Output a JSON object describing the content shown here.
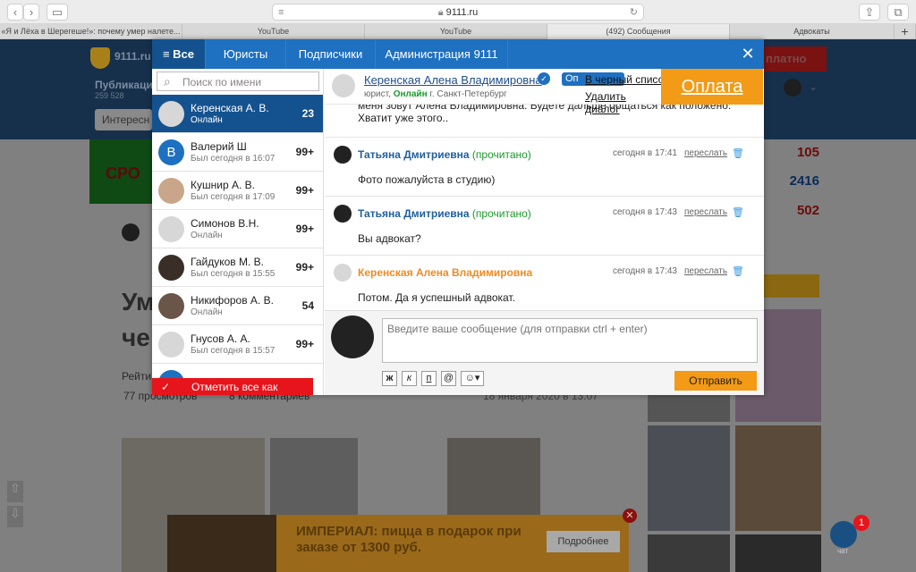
{
  "browser": {
    "url": "9111.ru",
    "tabs": [
      {
        "label": "«Я и Лёха в Шерегеше!»: почему умер налете...",
        "active": false
      },
      {
        "label": "YouTube",
        "active": false
      },
      {
        "label": "YouTube",
        "active": false
      },
      {
        "label": "(492) Сообщения",
        "active": true
      },
      {
        "label": "Адвокаты",
        "active": false
      }
    ]
  },
  "background": {
    "site_name": "9111.ru",
    "publications": "Публикаци",
    "pub_count": "259 528",
    "interesting": "Интересн",
    "headline_1": "Ум",
    "headline_2": "че",
    "rating": "Рейти",
    "views": "77 просмотров",
    "comments": "8 комментариев",
    "date": "18 января 2020 в 13:07",
    "right_counts": [
      "105",
      "2416",
      "502"
    ],
    "promo_label": "платно",
    "ad_title": "ИМПЕРИАЛ: пицца в подарок при заказе от 1300 руб.",
    "ad_button": "Подробнее",
    "chat_widget_label": "чат",
    "chat_badge": "1"
  },
  "modal": {
    "tabs": [
      {
        "label": "Все",
        "active": true
      },
      {
        "label": "Юристы",
        "active": false
      },
      {
        "label": "Подписчики",
        "active": false
      },
      {
        "label": "Администрация 9111",
        "active": false
      }
    ],
    "search_placeholder": "Поиск по имени",
    "contacts": [
      {
        "name": "Керенская А. В.",
        "status": "Онлайн",
        "count": "23",
        "selected": true,
        "avatar": "placeholder"
      },
      {
        "name": "Валерий Ш",
        "status": "Был сегодня в 16:07",
        "count": "99+",
        "selected": false,
        "avatar": "letter",
        "letter": "В"
      },
      {
        "name": "Кушнир А. В.",
        "status": "Был сегодня в 17:09",
        "count": "99+",
        "selected": false,
        "avatar": "photo"
      },
      {
        "name": "Симонов В.Н.",
        "status": "Онлайн",
        "count": "99+",
        "selected": false,
        "avatar": "placeholder"
      },
      {
        "name": "Гайдуков М. В.",
        "status": "Был сегодня в 15:55",
        "count": "99+",
        "selected": false,
        "avatar": "photo"
      },
      {
        "name": "Никифоров А. В.",
        "status": "Онлайн",
        "count": "54",
        "selected": false,
        "avatar": "photo"
      },
      {
        "name": "Гнусов А. А.",
        "status": "Был сегодня в 15:57",
        "count": "99+",
        "selected": false,
        "avatar": "placeholder"
      },
      {
        "name": "",
        "status": "",
        "count": "",
        "selected": false,
        "avatar": "letter",
        "letter": ""
      }
    ],
    "mark_all": "Отметить все как",
    "chat_header": {
      "name": "Керенская Алена Владимировна",
      "role": "юрист,",
      "online": "Онлайн",
      "city": "г. Санкт-Петербург"
    },
    "partial_message": "меня зовут Алена Владимировна. Будете дальше общаться как положено.",
    "partial_message_2": "Хватит уже этого..",
    "messages": [
      {
        "author": "Татьяна Дмитриевна",
        "read": "(прочитано)",
        "time": "сегодня в 17:41",
        "forward": "переслать",
        "body": "Фото пожалуйста в студию)",
        "own": false
      },
      {
        "author": "Татьяна Дмитриевна",
        "read": "(прочитано)",
        "time": "сегодня в 17:43",
        "forward": "переслать",
        "body": "Вы адвокат?",
        "own": false
      },
      {
        "author": "Керенская Алена Владимировна",
        "read": "",
        "time": "сегодня в 17:43",
        "forward": "переслать",
        "body": "Потом. Да я успешный адвокат.",
        "own": true
      }
    ],
    "compose_placeholder": "Введите ваше сообщение (для отправки ctrl + enter)",
    "format_buttons": [
      "ж",
      "к",
      "п"
    ],
    "send_label": "Отправить"
  },
  "overlay": {
    "pay_label": "Оплата",
    "context_menu": [
      "В черный список",
      "Удалить диалог"
    ],
    "context_label": "Оп"
  },
  "colors": {
    "modal_blue": "#1e70c1",
    "selected_blue": "#14528f",
    "orange": "#f39a16",
    "red": "#e8141b"
  }
}
